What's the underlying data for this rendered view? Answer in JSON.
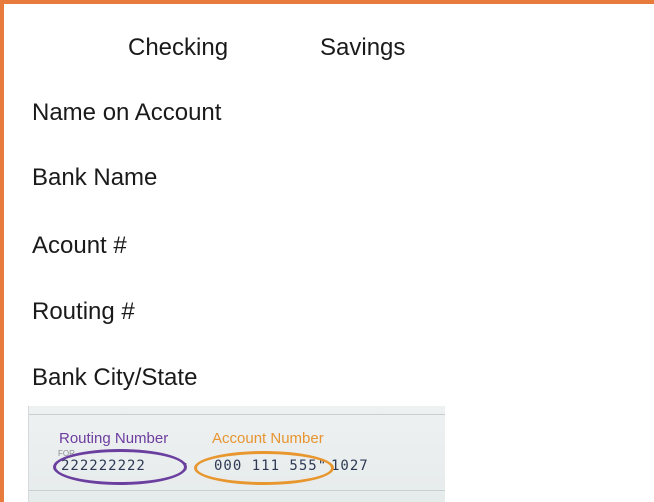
{
  "account_type": {
    "options": [
      "Checking",
      "Savings"
    ]
  },
  "fields": {
    "name_on_account": "Name on Account",
    "bank_name": "Bank Name",
    "account_number": "Acount #",
    "routing_number": "Routing #",
    "bank_city_state": "Bank City/State"
  },
  "check_image": {
    "routing_label": "Routing Number",
    "account_label": "Account Number",
    "for_text": "FOR",
    "routing_digits": "222222222",
    "account_digits": "000 111 555\"",
    "check_digits": "1027",
    "routing_color": "#6b3fa0",
    "account_color": "#e8962e"
  },
  "accent_color": "#e77b3c"
}
